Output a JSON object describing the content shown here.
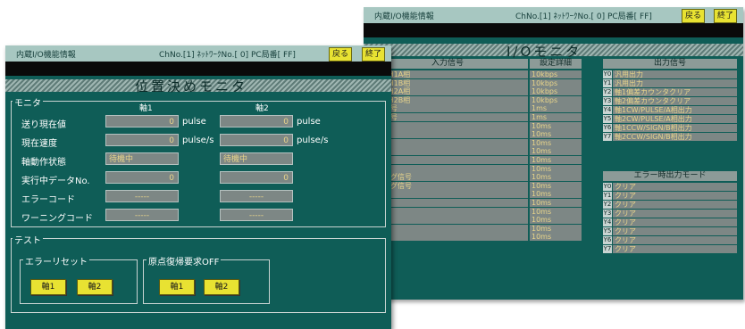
{
  "back": {
    "title": "内蔵I/O機能情報",
    "info": "ChNo.[1] ﾈｯﾄﾜｰｸNo.[ 0] PC局番[ FF]",
    "buttons": {
      "back": "戻る",
      "end": "終了"
    },
    "heading": "I/Oモニタ",
    "input_headers": {
      "signal": "入力信号",
      "detail": "設定詳細"
    },
    "output_header": "出力信号",
    "inputs": [
      {
        "name": "ｶｳﾝﾀCH1A相",
        "detail": "10kbps"
      },
      {
        "name": "ｶｳﾝﾀCH1B相",
        "detail": "10kbps"
      },
      {
        "name": "ｶｳﾝﾀCH2A相",
        "detail": "10kbps"
      },
      {
        "name": "ｶｳﾝﾀCH2B相",
        "detail": "10kbps"
      },
      {
        "name": "零点信号",
        "detail": "1ms"
      },
      {
        "name": "零点信号",
        "detail": "1ms"
      },
      {
        "name": "汎入力",
        "detail": "10ms"
      },
      {
        "name": "汎入力",
        "detail": "10ms"
      },
      {
        "name": "汎入力",
        "detail": "10ms"
      },
      {
        "name": "汎入力",
        "detail": "10ms"
      },
      {
        "name": "汎入力",
        "detail": "10ms"
      },
      {
        "name": "汎入力",
        "detail": "10ms"
      },
      {
        "name": "原点ドグ信号",
        "detail": "10ms"
      },
      {
        "name": "原点ドグ信号",
        "detail": "10ms"
      },
      {
        "name": "汎入力",
        "detail": "10ms"
      },
      {
        "name": "汎入力",
        "detail": "10ms"
      },
      {
        "name": "汎入力",
        "detail": "10ms"
      },
      {
        "name": "汎入力",
        "detail": "10ms"
      },
      {
        "name": "汎入力",
        "detail": "10ms"
      },
      {
        "name": "汎入力",
        "detail": "10ms"
      }
    ],
    "outputs": [
      {
        "no": "Y0",
        "label": "汎用出力"
      },
      {
        "no": "Y1",
        "label": "汎用出力"
      },
      {
        "no": "Y2",
        "label": "軸1偏差カウンタクリア"
      },
      {
        "no": "Y3",
        "label": "軸2偏差カウンタクリア"
      },
      {
        "no": "Y4",
        "label": "軸1CW/PULSE/A相出力"
      },
      {
        "no": "Y5",
        "label": "軸2CW/PULSE/A相出力"
      },
      {
        "no": "Y6",
        "label": "軸1CCW/SIGN/B相出力"
      },
      {
        "no": "Y7",
        "label": "軸2CCW/SIGN/B相出力"
      }
    ],
    "error_header": "エラー時出力モード",
    "error_modes": [
      {
        "no": "Y0",
        "label": "クリア"
      },
      {
        "no": "Y1",
        "label": "クリア"
      },
      {
        "no": "Y2",
        "label": "クリア"
      },
      {
        "no": "Y3",
        "label": "クリア"
      },
      {
        "no": "Y4",
        "label": "クリア"
      },
      {
        "no": "Y5",
        "label": "クリア"
      },
      {
        "no": "Y6",
        "label": "クリア"
      },
      {
        "no": "Y7",
        "label": "クリア"
      }
    ]
  },
  "front": {
    "title": "内蔵I/O機能情報",
    "info": "ChNo.[1] ﾈｯﾄﾜｰｸNo.[ 0] PC局番[ FF]",
    "buttons": {
      "back": "戻る",
      "end": "終了"
    },
    "heading": "位置決めモニタ",
    "monitor_label": "モニタ",
    "axis1": "軸1",
    "axis2": "軸2",
    "rows": {
      "position": {
        "label": "送り現在値",
        "axis1": "0",
        "axis2": "0",
        "unit": "pulse"
      },
      "speed": {
        "label": "現在速度",
        "axis1": "0",
        "axis2": "0",
        "unit": "pulse/s"
      },
      "state": {
        "label": "軸動作状態",
        "axis1": "待機中",
        "axis2": "待機中"
      },
      "data_no": {
        "label": "実行中データNo.",
        "axis1": "0",
        "axis2": "0"
      },
      "error_code": {
        "label": "エラーコード",
        "axis1": "-----",
        "axis2": "-----"
      },
      "warning_code": {
        "label": "ワーニングコード",
        "axis1": "-----",
        "axis2": "-----"
      }
    },
    "test_label": "テスト",
    "error_reset": {
      "label": "エラーリセット",
      "btn1": "軸1",
      "btn2": "軸2"
    },
    "home_request": {
      "label": "原点復帰要求OFF",
      "btn1": "軸1",
      "btn2": "軸2"
    }
  },
  "colors": {
    "panel": "#0f5d57",
    "accent_button": "#e8e232",
    "value_text": "#e8d48a",
    "cell": "#7d8785"
  }
}
